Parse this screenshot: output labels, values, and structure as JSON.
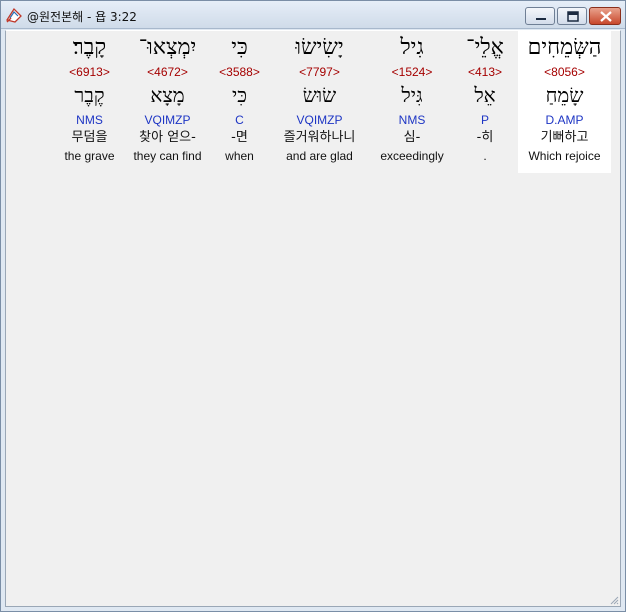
{
  "window": {
    "title": "@원전본해 - 욥 3:22",
    "minimize_label": "minimize",
    "maximize_label": "maximize",
    "close_label": "close"
  },
  "words": [
    {
      "hebrew": "הַשְּׂמֵחִים",
      "strong": "<8056>",
      "lemma": "שָׂמֵחַ",
      "morph": "D.AMP",
      "korean": "기뻐하고",
      "english": "Which rejoice",
      "selected": true
    },
    {
      "hebrew": "אֱלֵי־",
      "strong": "<413>",
      "lemma": "אֵל",
      "morph": "P",
      "korean": "-히",
      "english": ".",
      "selected": false
    },
    {
      "hebrew": "גִיל",
      "strong": "<1524>",
      "lemma": "גִּיל",
      "morph": "NMS",
      "korean": "심-",
      "english": "exceedingly",
      "selected": false
    },
    {
      "hebrew": "יָשִׂישׂוּ",
      "strong": "<7797>",
      "lemma": "שׂוּשׂ",
      "morph": "VQIMZP",
      "korean": "즐거워하나니",
      "english": "and are glad",
      "selected": false
    },
    {
      "hebrew": "כִּי",
      "strong": "<3588>",
      "lemma": "כִּי",
      "morph": "C",
      "korean": "-면",
      "english": "when",
      "selected": false
    },
    {
      "hebrew": "יִמְצְאוּ־",
      "strong": "<4672>",
      "lemma": "מָצָא",
      "morph": "VQIMZP",
      "korean": "찾아 얻으-",
      "english": "they can find",
      "selected": false
    },
    {
      "hebrew": "קָבֶר׃",
      "strong": "<6913>",
      "lemma": "קֶבֶר",
      "morph": "NMS",
      "korean": "무덤을",
      "english": "the grave",
      "selected": false
    }
  ]
}
